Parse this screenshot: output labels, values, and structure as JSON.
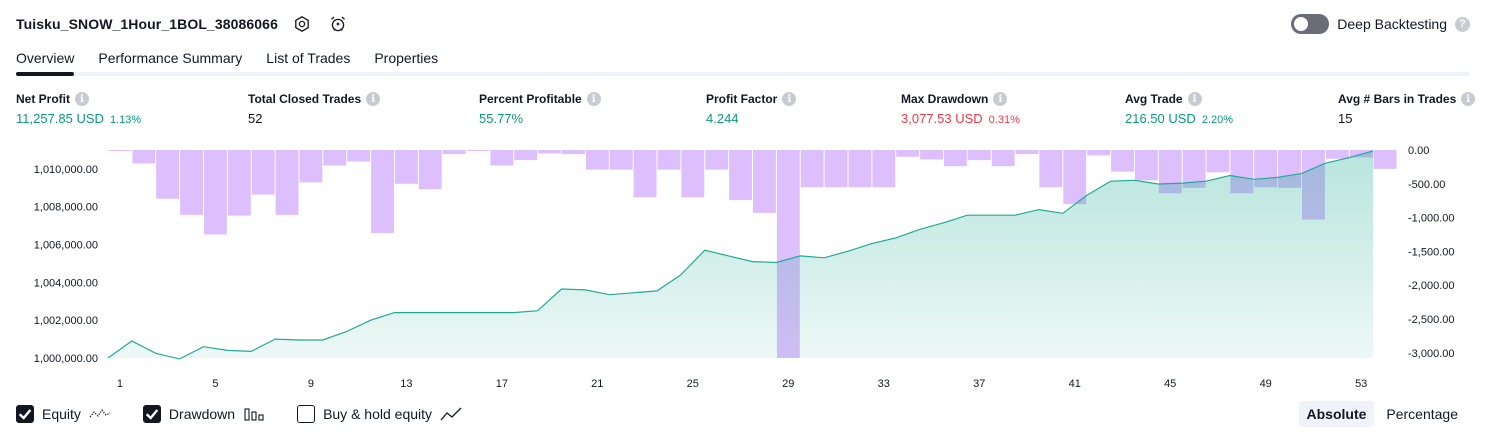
{
  "header": {
    "title": "Tuisku_SNOW_1Hour_1BOL_38086066",
    "settings_icon": "gear-icon",
    "alert_icon": "alarm-clock-icon"
  },
  "deep_backtesting": {
    "label": "Deep Backtesting",
    "enabled": false,
    "help_icon": "question-icon"
  },
  "tabs": [
    {
      "label": "Overview",
      "active": true
    },
    {
      "label": "Performance Summary",
      "active": false
    },
    {
      "label": "List of Trades",
      "active": false
    },
    {
      "label": "Properties",
      "active": false
    }
  ],
  "metrics": {
    "net_profit": {
      "label": "Net Profit",
      "value": "11,257.85 USD",
      "pct": "1.13%"
    },
    "total_closed_trades": {
      "label": "Total Closed Trades",
      "value": "52"
    },
    "percent_profitable": {
      "label": "Percent Profitable",
      "value": "55.77%"
    },
    "profit_factor": {
      "label": "Profit Factor",
      "value": "4.244"
    },
    "max_drawdown": {
      "label": "Max Drawdown",
      "value": "3,077.53 USD",
      "pct": "0.31%"
    },
    "avg_trade": {
      "label": "Avg Trade",
      "value": "216.50 USD",
      "pct": "2.20%"
    },
    "avg_bars": {
      "label": "Avg # Bars in Trades",
      "value": "15"
    }
  },
  "legend": {
    "equity": {
      "label": "Equity",
      "checked": true
    },
    "drawdown": {
      "label": "Drawdown",
      "checked": true
    },
    "buy_hold": {
      "label": "Buy & hold equity",
      "checked": false
    }
  },
  "mode": {
    "absolute": "Absolute",
    "percentage": "Percentage",
    "selected": "Absolute"
  },
  "colors": {
    "equity_line": "#22ab94",
    "equity_fill": "#22ab94",
    "drawdown_bar": "#d8b4fe",
    "positive": "#089981",
    "negative": "#f23645"
  },
  "chart_data": {
    "type": "area",
    "x": [
      1,
      2,
      3,
      4,
      5,
      6,
      7,
      8,
      9,
      10,
      11,
      12,
      13,
      14,
      15,
      16,
      17,
      18,
      19,
      20,
      21,
      22,
      23,
      24,
      25,
      26,
      27,
      28,
      29,
      30,
      31,
      32,
      33,
      34,
      35,
      36,
      37,
      38,
      39,
      40,
      41,
      42,
      43,
      44,
      45,
      46,
      47,
      48,
      49,
      50,
      51,
      52,
      53
    ],
    "x_ticks": [
      "1",
      "5",
      "9",
      "13",
      "17",
      "21",
      "25",
      "29",
      "33",
      "37",
      "41",
      "45",
      "49",
      "53"
    ],
    "series": [
      {
        "name": "Equity",
        "axis": "left",
        "values": [
          1000000,
          1000900,
          1000250,
          999950,
          1000600,
          1000400,
          1000350,
          1001000,
          1000950,
          1000950,
          1001400,
          1002000,
          1002400,
          1002400,
          1002400,
          1002400,
          1002400,
          1002400,
          1002500,
          1003650,
          1003600,
          1003350,
          1003450,
          1003550,
          1004400,
          1005700,
          1005400,
          1005100,
          1005050,
          1005400,
          1005300,
          1005650,
          1006050,
          1006350,
          1006800,
          1007150,
          1007550,
          1007550,
          1007550,
          1007850,
          1007650,
          1008600,
          1009350,
          1009400,
          1009200,
          1009250,
          1009350,
          1009650,
          1009450,
          1009550,
          1009750,
          1010300,
          1010600,
          1010950
        ]
      },
      {
        "name": "Drawdown",
        "axis": "right",
        "values": [
          0,
          -200,
          -720,
          -960,
          -1250,
          -970,
          -660,
          -960,
          -480,
          -230,
          -170,
          -1230,
          -500,
          -580,
          -60,
          0,
          -230,
          -150,
          -50,
          -60,
          -290,
          -290,
          -700,
          -290,
          -700,
          -290,
          -740,
          -930,
          -3077,
          -550,
          -550,
          -550,
          -550,
          -100,
          -140,
          -240,
          -150,
          -240,
          -60,
          -550,
          -800,
          -80,
          -320,
          -450,
          -640,
          -560,
          -330,
          -640,
          -550,
          -560,
          -1030,
          -130,
          -110,
          -280
        ]
      }
    ],
    "y_left": {
      "min": 1000000,
      "max": 1011000,
      "ticks": [
        "1,000,000.00",
        "1,002,000.00",
        "1,004,000.00",
        "1,006,000.00",
        "1,008,000.00",
        "1,010,000.00"
      ]
    },
    "y_right": {
      "min": -3077.53,
      "max": 0,
      "ticks": [
        "0.00",
        "-500.00",
        "-1,000.00",
        "-1,500.00",
        "-2,000.00",
        "-2,500.00",
        "-3,000.00"
      ]
    },
    "grid": false,
    "legend": "bottom-left"
  }
}
